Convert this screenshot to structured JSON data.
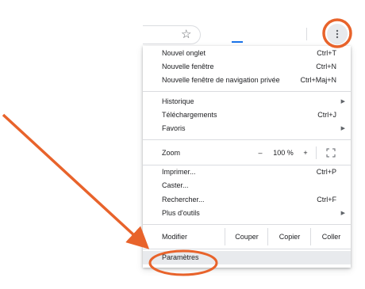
{
  "toolbar": {
    "star_icon": "star-icon",
    "menu_icon": "kebab-menu-icon",
    "accent_color": "#1a73e8"
  },
  "menu": {
    "new_tab": {
      "label": "Nouvel onglet",
      "shortcut": "Ctrl+T"
    },
    "new_window": {
      "label": "Nouvelle fenêtre",
      "shortcut": "Ctrl+N"
    },
    "incognito": {
      "label": "Nouvelle fenêtre de navigation privée",
      "shortcut": "Ctrl+Maj+N"
    },
    "history": {
      "label": "Historique"
    },
    "downloads": {
      "label": "Téléchargements",
      "shortcut": "Ctrl+J"
    },
    "bookmarks": {
      "label": "Favoris"
    },
    "zoom": {
      "label": "Zoom",
      "minus": "–",
      "value": "100 %",
      "plus": "+"
    },
    "print": {
      "label": "Imprimer...",
      "shortcut": "Ctrl+P"
    },
    "cast": {
      "label": "Caster..."
    },
    "find": {
      "label": "Rechercher...",
      "shortcut": "Ctrl+F"
    },
    "more_tools": {
      "label": "Plus d'outils"
    },
    "edit": {
      "label": "Modifier",
      "cut": "Couper",
      "copy": "Copier",
      "paste": "Coller"
    },
    "settings": {
      "label": "Paramètres"
    }
  },
  "annotation": {
    "color": "#e8632b"
  }
}
